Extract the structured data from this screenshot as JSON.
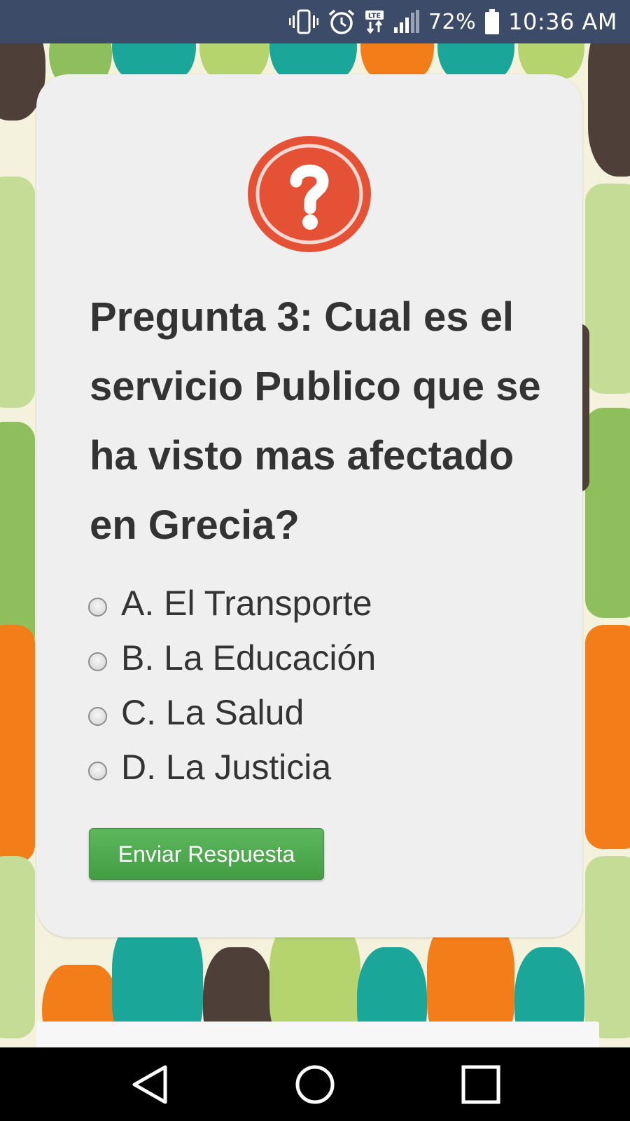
{
  "status_bar": {
    "battery_percent": "72%",
    "time": "10:36 AM",
    "icons": [
      "vibrate-icon",
      "alarm-icon",
      "lte-icon",
      "signal-icon",
      "battery-icon"
    ]
  },
  "quiz": {
    "question": "Pregunta 3: Cual es el servicio Publico que se ha visto mas afectado en Grecia?",
    "options": [
      {
        "label": "A. El Transporte"
      },
      {
        "label": "B. La Educación"
      },
      {
        "label": "C. La Salud"
      },
      {
        "label": "D. La Justicia"
      }
    ],
    "selected": null,
    "submit_label": "Enviar Respuesta"
  },
  "colors": {
    "accent_green": "#5cb85c",
    "question_icon": "#e45135",
    "status_bar": "#3c4b67"
  },
  "nav_bar": {
    "icons": [
      "back-icon",
      "home-icon",
      "recents-icon"
    ]
  }
}
